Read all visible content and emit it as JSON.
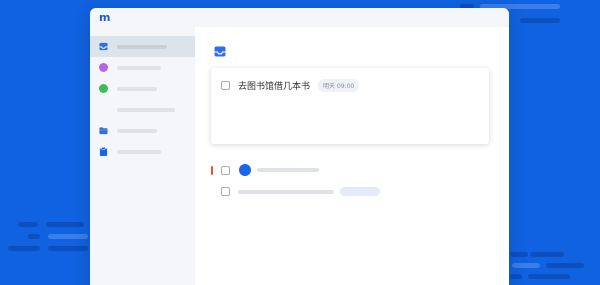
{
  "app": {
    "logo_text": "m"
  },
  "sidebar": {
    "items": [
      {
        "icon": "inbox-icon",
        "color": "#2f6fe0",
        "active": true
      },
      {
        "icon": "purple-dot-icon",
        "color": "#b565e6",
        "active": false
      },
      {
        "icon": "green-dot-icon",
        "color": "#3dba5a",
        "active": false
      },
      {
        "icon": "none",
        "color": "",
        "active": false
      },
      {
        "icon": "folder-icon",
        "color": "#2f6fe0",
        "active": false
      },
      {
        "icon": "clipboard-icon",
        "color": "#1a66e8",
        "active": false
      }
    ]
  },
  "main": {
    "section_icon": "inbox-icon",
    "task": {
      "title": "去图书馆借几本书",
      "due": "明天 09:00",
      "checked": false
    }
  },
  "colors": {
    "background": "#1162e0",
    "accent": "#1a66e8",
    "flag": "#e8542d"
  }
}
